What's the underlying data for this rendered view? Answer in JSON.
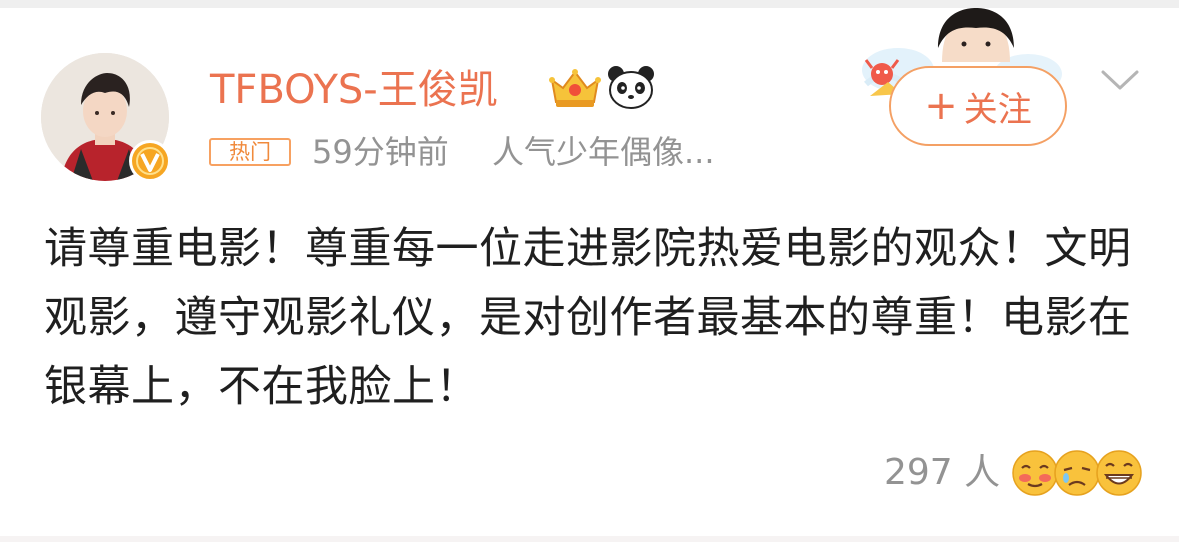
{
  "post": {
    "username": "TFBOYS-王俊凯",
    "hot_tag": "热门",
    "time_ago": "59分钟前",
    "source": "人气少年偶像...",
    "follow_label": "关注",
    "text": "请尊重电影！尊重每一位走进影院热爱电影的观众！文明观影，遵守观影礼仪，是对创作者最基本的尊重！电影在银幕上，不在我脸上！",
    "likes_count": "297 人",
    "icons": {
      "avatar": "user-avatar-photo",
      "verified": "verified-v-badge-icon",
      "crown": "crown-icon",
      "panda": "panda-icon",
      "more": "chevron-down-icon",
      "reactions": [
        "blush-emoji-icon",
        "sad-emoji-icon",
        "laugh-emoji-icon"
      ]
    },
    "colors": {
      "username": "#eb7350",
      "meta": "#939393",
      "accent_orange": "#f4a064",
      "text": "#1f1f1f"
    }
  }
}
